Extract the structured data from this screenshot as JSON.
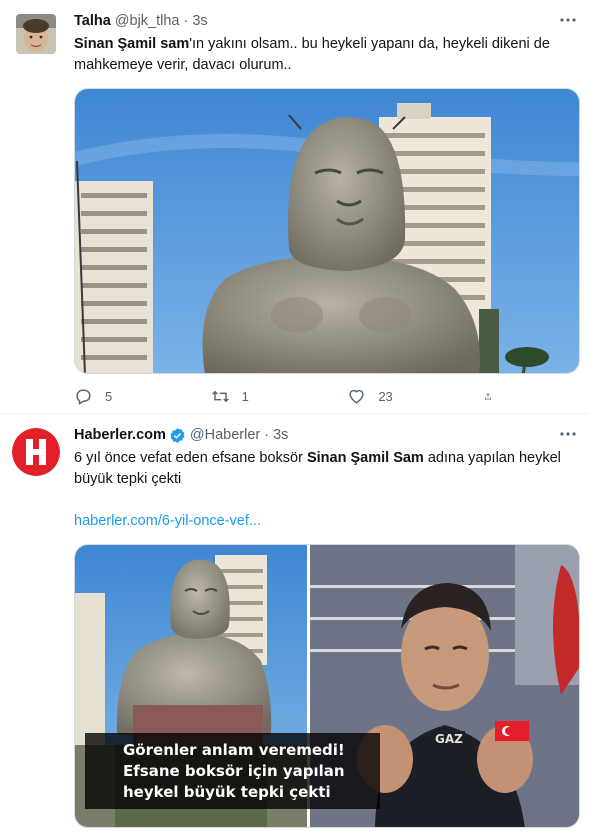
{
  "tweets": [
    {
      "author": {
        "name": "Talha",
        "handle": "@bjk_tlha",
        "time": "3s",
        "avatar_icon": "user-photo-avatar"
      },
      "text": {
        "bold": "Sinan Şamil sam",
        "rest": "'ın yakını olsam.. bu heykeli yapanı da, heykeli dikeni de mahkemeye verir, davacı olurum.."
      },
      "media": {
        "type": "photo",
        "description_icon": "statue-photo"
      },
      "stats": {
        "replies": "5",
        "retweets": "1",
        "likes": "23"
      }
    },
    {
      "author": {
        "name": "Haberler.com",
        "handle": "@Haberler",
        "time": "3s",
        "verified": true,
        "avatar_icon": "haberler-logo"
      },
      "text": {
        "before": "6 yıl önce vefat eden efsane boksör ",
        "bold": "Sinan Şamil Sam",
        "after": " adına yapılan heykel büyük tepki çekti"
      },
      "link": "haberler.com/6-yil-once-vef...",
      "card": {
        "caption": "Görenler anlam veremedi! Efsane boksör için yapılan heykel büyük tepki çekti",
        "shirt_text": "GAZ"
      }
    }
  ],
  "colors": {
    "accent": "#1d9bf0",
    "secondary": "#536471",
    "border": "#cfd9de",
    "brand_red": "#e3202a"
  }
}
